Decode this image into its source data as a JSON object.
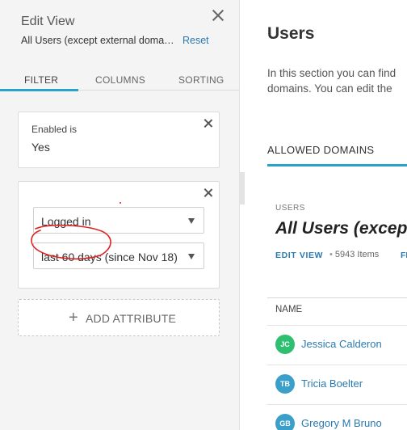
{
  "panel": {
    "title": "Edit View",
    "view_name": "All Users (except external domai…",
    "reset": "Reset",
    "tabs": [
      "FILTER",
      "COLUMNS",
      "SORTING"
    ],
    "active_tab": "FILTER",
    "filters": [
      {
        "label": "Enabled is",
        "value": "Yes"
      },
      {
        "field": "Logged in",
        "period": "last 60 days (since Nov 18)"
      }
    ],
    "add_attribute": "ADD ATTRIBUTE",
    "icons": [
      "close-icon",
      "plus-icon",
      "chevron-down-icon"
    ]
  },
  "main": {
    "title": "Users",
    "intro_lines": [
      "In this section you can find",
      "domains. You can edit the"
    ],
    "tab": "ALLOWED DOMAINS",
    "list_label": "USERS",
    "list_title": "All Users (excep",
    "edit_view": "EDIT VIEW",
    "item_count": "5943 Items",
    "next_link": "FI",
    "column_header": "NAME",
    "rows": [
      {
        "initials": "JC",
        "name": "Jessica Calderon",
        "color": "#2fbf71"
      },
      {
        "initials": "TB",
        "name": "Tricia Boelter",
        "color": "#3aa0c9"
      },
      {
        "initials": "GB",
        "name": "Gregory M Bruno",
        "color": "#3aa0c9"
      }
    ]
  },
  "colors": {
    "accent": "#2aa3c8",
    "link": "#2a7ab0",
    "annotation": "#e02020"
  }
}
